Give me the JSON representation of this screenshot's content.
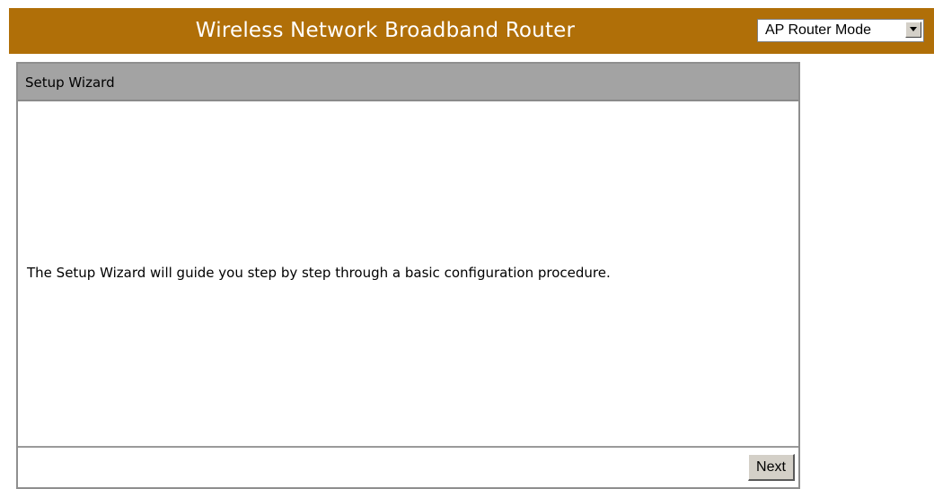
{
  "header": {
    "title": "Wireless Network Broadband Router",
    "mode_select": {
      "selected": "AP Router Mode",
      "arrow_icon": "dropdown-arrow-icon"
    },
    "background_color": "#b06f08"
  },
  "panel": {
    "title": "Setup Wizard",
    "description": "The Setup Wizard will guide you step by step through a basic configuration procedure.",
    "next_label": "Next"
  }
}
